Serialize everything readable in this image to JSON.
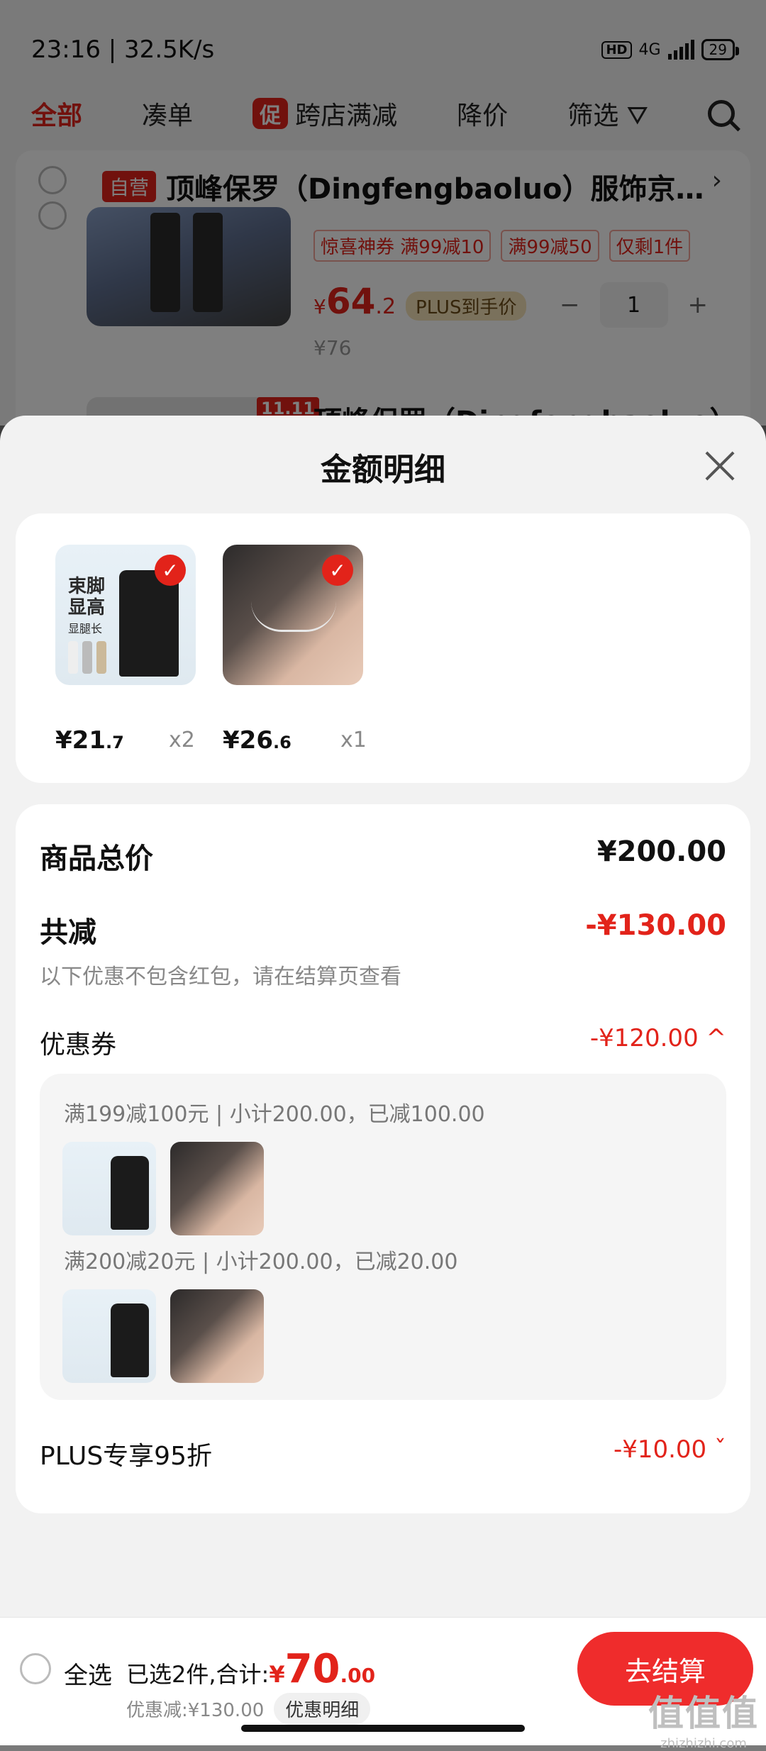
{
  "status_bar": {
    "time_speed": "23:16 | 32.5K/s",
    "hd": "HD",
    "network": "4G",
    "battery": "29"
  },
  "cart_tabs": {
    "all": "全部",
    "combine": "凑单",
    "promo_tag": "促",
    "cross_store": "跨店满减",
    "price_drop": "降价",
    "filter": "筛选"
  },
  "cart_item": {
    "self_tag": "自营",
    "store_name": "顶峰保罗（Dingfengbaoluo）服饰京…",
    "badges": [
      "惊喜神券 满99减10",
      "满99减50",
      "仅剩1件"
    ],
    "price_symbol": "¥",
    "price_int": "64",
    "price_dec": ".2",
    "plus_tag": "PLUS到手价",
    "qty": "1",
    "qty_minus": "−",
    "qty_plus": "+",
    "old_price": "¥76",
    "next_tag": "11.11",
    "next_title": "顶峰保罗（Dingfengbaoluo）水洗"
  },
  "sheet": {
    "title": "金额明细",
    "goods": [
      {
        "price": "¥21",
        "price_dec": ".7",
        "qty": "x2",
        "thumb_text": [
          "束脚",
          "显高",
          "显腿长"
        ]
      },
      {
        "price": "¥26",
        "price_dec": ".6",
        "qty": "x1"
      }
    ],
    "total_label": "商品总价",
    "total_value": "¥200.00",
    "discount_label": "共减",
    "discount_value": "-¥130.00",
    "discount_note": "以下优惠不包含红包，请在结算页查看",
    "coupon_label": "优惠券",
    "coupon_value": "-¥120.00 ^",
    "coupon_lines": [
      "满199减100元 | 小计200.00，已减100.00",
      "满200减20元 | 小计200.00，已减20.00"
    ],
    "plus_label": "PLUS专享95折",
    "plus_value": "-¥10.00 ˇ"
  },
  "bottom_bar": {
    "select_all": "全选",
    "summary_prefix": "已选2件,合计:",
    "total_symbol": "¥",
    "total_int": "70",
    "total_dec": ".00",
    "discount_text": "优惠减:¥130.00",
    "detail_button": "优惠明细",
    "checkout_button": "去结算"
  },
  "watermark": {
    "main": "值值值",
    "sub": "zhizhizhi.com"
  },
  "colors": {
    "accent": "#e2231a",
    "checkout": "#ef2c2c"
  }
}
